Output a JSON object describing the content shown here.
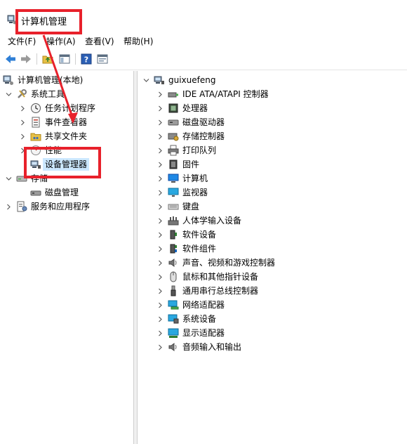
{
  "window": {
    "title": "计算机管理"
  },
  "menubar": {
    "items": [
      {
        "label": "文件(F)"
      },
      {
        "label": "操作(A)"
      },
      {
        "label": "查看(V)"
      },
      {
        "label": "帮助(H)"
      }
    ]
  },
  "toolbar": {
    "buttons": [
      {
        "icon": "back-arrow-icon"
      },
      {
        "icon": "forward-arrow-icon"
      },
      {
        "icon": "up-folder-icon"
      },
      {
        "icon": "show-hide-tree-icon"
      },
      {
        "icon": "help-icon"
      },
      {
        "icon": "properties-icon"
      }
    ]
  },
  "tree": {
    "root": "计算机管理(本地)",
    "system_tools": "系统工具",
    "task_scheduler": "任务计划程序",
    "event_viewer": "事件查看器",
    "shared_folders": "共享文件夹",
    "performance": "性能",
    "device_manager": "设备管理器",
    "storage": "存储",
    "disk_management": "磁盘管理",
    "services_apps": "服务和应用程序"
  },
  "devices": {
    "computer_name": "guixuefeng",
    "categories": [
      {
        "label": "IDE ATA/ATAPI 控制器",
        "icon": "ide-controller-icon"
      },
      {
        "label": "处理器",
        "icon": "processor-icon"
      },
      {
        "label": "磁盘驱动器",
        "icon": "disk-drive-icon"
      },
      {
        "label": "存储控制器",
        "icon": "storage-controller-icon"
      },
      {
        "label": "打印队列",
        "icon": "printer-icon"
      },
      {
        "label": "固件",
        "icon": "firmware-icon"
      },
      {
        "label": "计算机",
        "icon": "computer-icon"
      },
      {
        "label": "监视器",
        "icon": "monitor-icon"
      },
      {
        "label": "键盘",
        "icon": "keyboard-icon"
      },
      {
        "label": "人体学输入设备",
        "icon": "hid-icon"
      },
      {
        "label": "软件设备",
        "icon": "software-device-icon"
      },
      {
        "label": "软件组件",
        "icon": "software-component-icon"
      },
      {
        "label": "声音、视频和游戏控制器",
        "icon": "sound-icon"
      },
      {
        "label": "鼠标和其他指针设备",
        "icon": "mouse-icon"
      },
      {
        "label": "通用串行总线控制器",
        "icon": "usb-icon"
      },
      {
        "label": "网络适配器",
        "icon": "network-adapter-icon"
      },
      {
        "label": "系统设备",
        "icon": "system-device-icon"
      },
      {
        "label": "显示适配器",
        "icon": "display-adapter-icon"
      },
      {
        "label": "音频输入和输出",
        "icon": "audio-io-icon"
      }
    ]
  },
  "colors": {
    "annotation": "#e8212b",
    "selection": "#cce8ff",
    "back_arrow": "#2f7fd6"
  }
}
